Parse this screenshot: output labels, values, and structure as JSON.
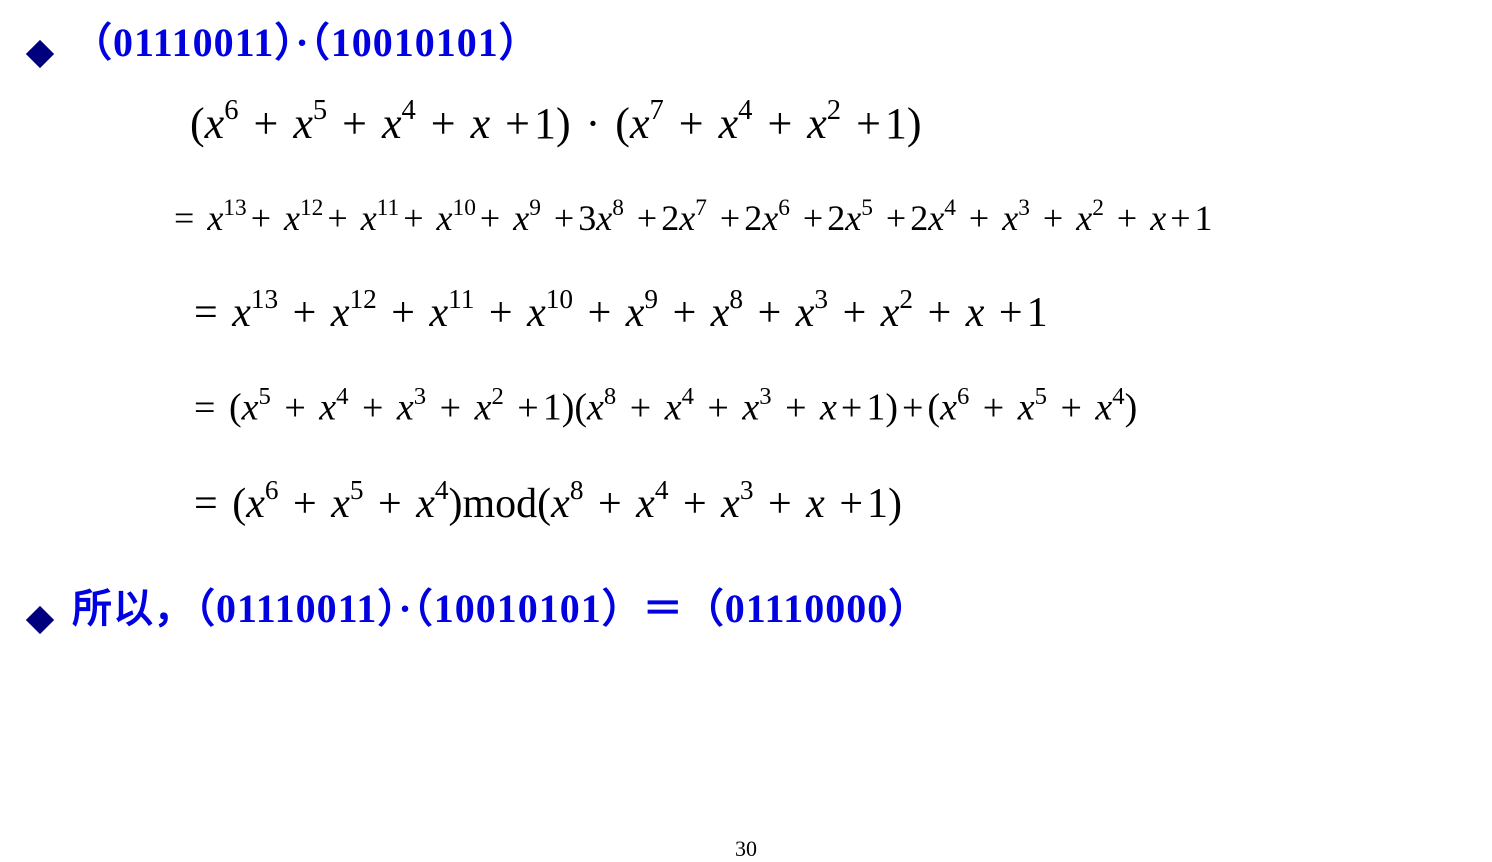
{
  "header": {
    "expression": "（01110011）·（10010101）"
  },
  "math": {
    "line1_html": "<span class='paren'>(</span><span class='var'>x</span><sup>6</sup> <span class='op'>+</span> <span class='var'>x</span><sup>5</sup> <span class='op'>+</span> <span class='var'>x</span><sup>4</sup> <span class='op'>+</span> <span class='var'>x</span> <span class='op'>+</span><span class='num'>1</span><span class='paren'>)</span> <span class='op'>·</span> <span class='paren'>(</span><span class='var'>x</span><sup>7</sup> <span class='op'>+</span> <span class='var'>x</span><sup>4</sup> <span class='op'>+</span> <span class='var'>x</span><sup>2</sup> <span class='op'>+</span><span class='num'>1</span><span class='paren'>)</span>",
    "line2_html": "<span class='op'>=</span> <span class='var'>x</span><sup>13</sup><span class='op'>+</span> <span class='var'>x</span><sup>12</sup><span class='op'>+</span> <span class='var'>x</span><sup>11</sup><span class='op'>+</span> <span class='var'>x</span><sup>10</sup><span class='op'>+</span> <span class='var'>x</span><sup>9</sup> <span class='op'>+</span><span class='num'>3</span><span class='var'>x</span><sup>8</sup> <span class='op'>+</span><span class='num'>2</span><span class='var'>x</span><sup>7</sup> <span class='op'>+</span><span class='num'>2</span><span class='var'>x</span><sup>6</sup> <span class='op'>+</span><span class='num'>2</span><span class='var'>x</span><sup>5</sup> <span class='op'>+</span><span class='num'>2</span><span class='var'>x</span><sup>4</sup> <span class='op'>+</span> <span class='var'>x</span><sup>3</sup> <span class='op'>+</span> <span class='var'>x</span><sup>2</sup> <span class='op'>+</span> <span class='var'>x</span><span class='op'>+</span><span class='num'>1</span>",
    "line3_html": "<span class='op'>=</span> <span class='var'>x</span><sup>13</sup> <span class='op'>+</span> <span class='var'>x</span><sup>12</sup> <span class='op'>+</span> <span class='var'>x</span><sup>11</sup> <span class='op'>+</span> <span class='var'>x</span><sup>10</sup> <span class='op'>+</span> <span class='var'>x</span><sup>9</sup> <span class='op'>+</span> <span class='var'>x</span><sup>8</sup> <span class='op'>+</span> <span class='var'>x</span><sup>3</sup> <span class='op'>+</span> <span class='var'>x</span><sup>2</sup> <span class='op'>+</span> <span class='var'>x</span> <span class='op'>+</span><span class='num'>1</span>",
    "line4_html": "<span class='op'>=</span> <span class='paren'>(</span><span class='var'>x</span><sup>5</sup> <span class='op'>+</span> <span class='var'>x</span><sup>4</sup> <span class='op'>+</span> <span class='var'>x</span><sup>3</sup> <span class='op'>+</span> <span class='var'>x</span><sup>2</sup> <span class='op'>+</span><span class='num'>1</span><span class='paren'>)(</span><span class='var'>x</span><sup>8</sup> <span class='op'>+</span> <span class='var'>x</span><sup>4</sup> <span class='op'>+</span> <span class='var'>x</span><sup>3</sup> <span class='op'>+</span> <span class='var'>x</span><span class='op'>+</span><span class='num'>1</span><span class='paren'>)</span><span class='op'>+</span><span class='paren'>(</span><span class='var'>x</span><sup>6</sup> <span class='op'>+</span> <span class='var'>x</span><sup>5</sup> <span class='op'>+</span> <span class='var'>x</span><sup>4</sup><span class='paren'>)</span>",
    "line5_html": "<span class='op'>=</span> <span class='paren'>(</span><span class='var'>x</span><sup>6</sup> <span class='op'>+</span> <span class='var'>x</span><sup>5</sup> <span class='op'>+</span> <span class='var'>x</span><sup>4</sup><span class='paren'>)</span><span class='modtxt'>mod</span><span class='paren'>(</span><span class='var'>x</span><sup>8</sup> <span class='op'>+</span> <span class='var'>x</span><sup>4</sup> <span class='op'>+</span> <span class='var'>x</span><sup>3</sup> <span class='op'>+</span> <span class='var'>x</span> <span class='op'>+</span><span class='num'>1</span><span class='paren'>)</span>"
  },
  "footer": {
    "result": "所以，（01110011）·（10010101）＝（01110000）"
  },
  "page_number": "30"
}
